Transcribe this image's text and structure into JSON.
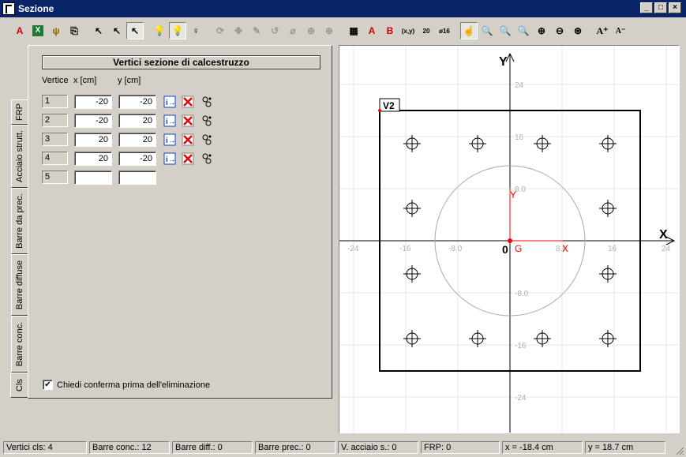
{
  "window": {
    "title": "Sezione"
  },
  "tabs": [
    "FRP",
    "Acciaio strutt.",
    "Barre da prec.",
    "Barre diffuse",
    "Barre conc.",
    "Cls"
  ],
  "panel": {
    "group_title": "Vertici sezione di calcestruzzo",
    "col_vertice": "Vertice",
    "col_x": "x [cm]",
    "col_y": "y [cm]",
    "rows": [
      {
        "id": "1",
        "x": "-20",
        "y": "-20"
      },
      {
        "id": "2",
        "x": "-20",
        "y": "20"
      },
      {
        "id": "3",
        "x": "20",
        "y": "20"
      },
      {
        "id": "4",
        "x": "20",
        "y": "-20"
      },
      {
        "id": "5",
        "x": "",
        "y": ""
      }
    ],
    "confirm_label": "Chiedi conferma prima dell'eliminazione",
    "confirm_checked": "✔"
  },
  "plot": {
    "axis_x": "X",
    "axis_y": "Y",
    "x_ticks": [
      "-24",
      "-16",
      "-8.0",
      "8.0",
      "16",
      "24"
    ],
    "y_ticks": [
      "24",
      "16",
      "8.0",
      "-8.0",
      "-16",
      "-24"
    ],
    "origin_label": "0",
    "g_label": "G",
    "local_x": "X",
    "local_y": "Y",
    "vertex_label": "V2"
  },
  "status": {
    "vertici": "Vertici cls: 4",
    "barre_conc": "Barre conc.: 12",
    "barre_diff": "Barre diff.: 0",
    "barre_prec": "Barre prec.: 0",
    "acciaio": "V. acciaio s.: 0",
    "frp": "FRP: 0",
    "xcoord": "x = -18.4 cm",
    "ycoord": "y = 18.7 cm"
  },
  "colors": {
    "titlebar": "#0a246a",
    "accent_red": "#ff0000",
    "grid": "#e0e0e0"
  }
}
